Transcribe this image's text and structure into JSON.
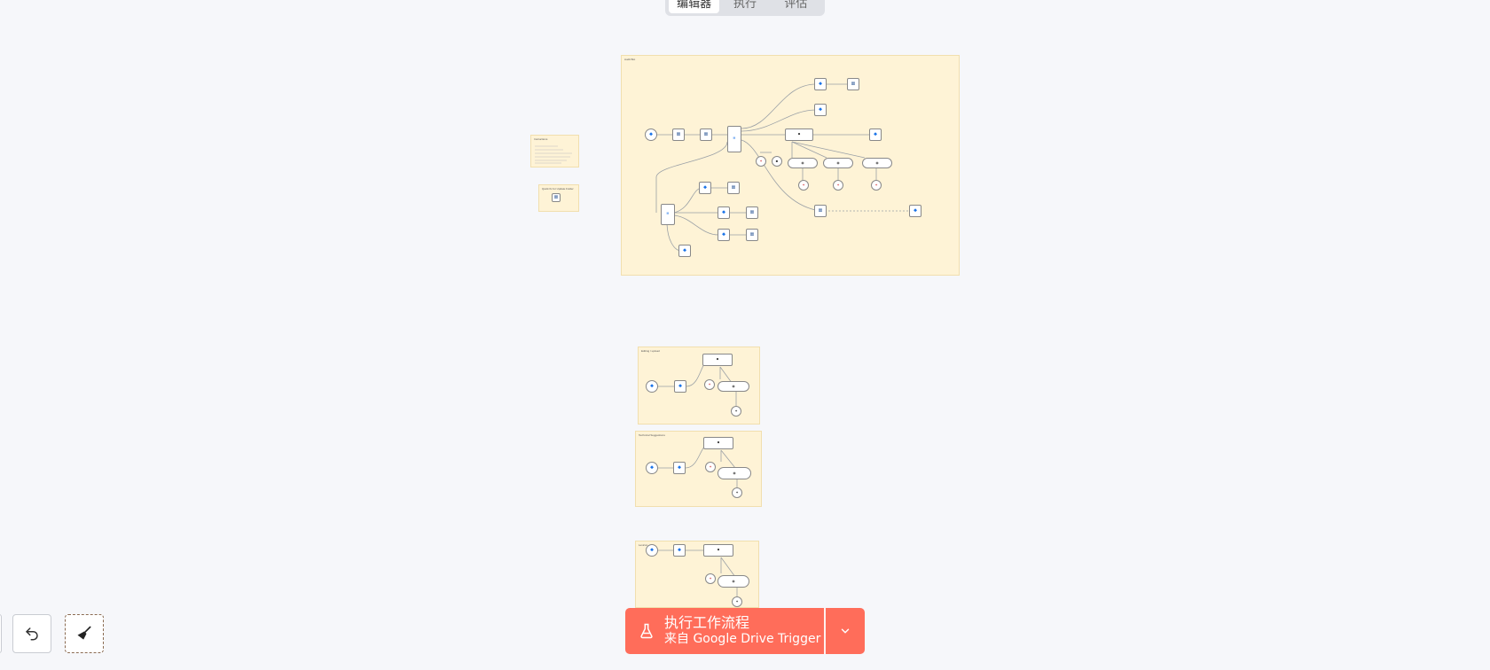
{
  "tabs": [
    {
      "label": "编辑器",
      "active": true
    },
    {
      "label": "执行",
      "active": false
    },
    {
      "label": "评估",
      "active": false
    }
  ],
  "canvas": {
    "main_sticky_title": "Audit Bot",
    "side_sticky_1_title": "Instructions",
    "side_sticky_2_title": "Quick fix for Update Folder",
    "group_1_title": "Editing / upload",
    "group_2_title": "Technical Suggestions",
    "group_3_title": "Lexicon"
  },
  "toolbar": {
    "undo_icon": "undo-icon",
    "clear_icon": "broom-icon"
  },
  "execute": {
    "label_line1": "执行工作流程",
    "label_line2": "来自 Google Drive Trigger",
    "flask_icon": "flask-icon",
    "dropdown_icon": "chevron-down-icon"
  },
  "colors": {
    "accent": "#ff6d5a",
    "sticky": "#fef3d6",
    "canvas": "#f6f7fa"
  }
}
